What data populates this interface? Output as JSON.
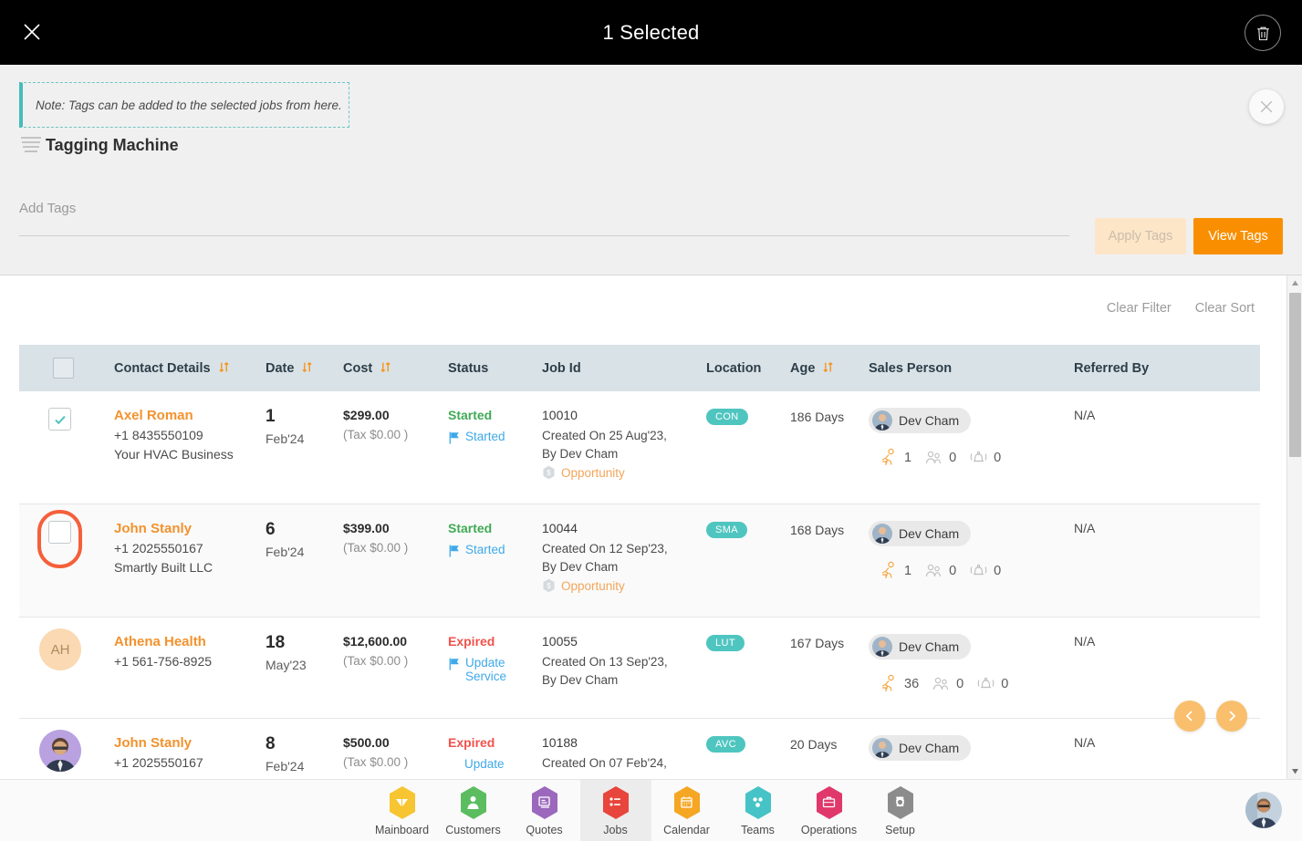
{
  "topbar": {
    "title": "1 Selected",
    "close_icon": "close-icon",
    "delete_icon": "trash-icon"
  },
  "tag_panel": {
    "note": "Note: Tags can be added to the selected jobs from here.",
    "heading": "Tagging Machine",
    "heading_icon": "stacked-lines-icon",
    "close_icon": "close-icon",
    "tags_input_value": "",
    "tags_input_placeholder": "Add Tags",
    "apply_label": "Apply Tags",
    "view_label": "View Tags",
    "accent_orange": "#f98f00",
    "accent_teal": "#45bdb9",
    "apply_disabled_bg": "#fde5c8"
  },
  "table_tools": {
    "clear_filter": "Clear Filter",
    "clear_sort": "Clear Sort"
  },
  "table": {
    "columns": [
      {
        "key": "select",
        "label": "",
        "sortable": false
      },
      {
        "key": "contact",
        "label": "Contact Details",
        "sortable": true
      },
      {
        "key": "date",
        "label": "Date",
        "sortable": true
      },
      {
        "key": "cost",
        "label": "Cost",
        "sortable": true
      },
      {
        "key": "status",
        "label": "Status",
        "sortable": false
      },
      {
        "key": "jobid",
        "label": "Job Id",
        "sortable": false
      },
      {
        "key": "location",
        "label": "Location",
        "sortable": false
      },
      {
        "key": "age",
        "label": "Age",
        "sortable": true
      },
      {
        "key": "sales",
        "label": "Sales Person",
        "sortable": false
      },
      {
        "key": "ref",
        "label": "Referred By",
        "sortable": false
      }
    ],
    "rows": [
      {
        "selected": true,
        "focused": false,
        "avatar_type": "none",
        "avatar_initials": "",
        "name": "Axel Roman",
        "phone": "+1 8435550109",
        "company": "Your HVAC Business",
        "day": "1",
        "month": "Feb'24",
        "cost": "$299.00",
        "tax": "(Tax $0.00 )",
        "status": "Started",
        "status_kind": "started",
        "status_sub": "Started",
        "job_id": "10010",
        "created_on": "Created On 25 Aug'23,",
        "created_by": "By Dev Cham",
        "opportunity": "Opportunity",
        "location": "CON",
        "age": "186 Days",
        "sales_person": "Dev Cham",
        "metric_calls": "1",
        "metric_team": "0",
        "metric_alerts": "0",
        "referred_by": "N/A"
      },
      {
        "selected": false,
        "focused": true,
        "avatar_type": "none",
        "avatar_initials": "",
        "name": "John Stanly",
        "phone": "+1 2025550167",
        "company": "Smartly Built LLC",
        "day": "6",
        "month": "Feb'24",
        "cost": "$399.00",
        "tax": "(Tax $0.00 )",
        "status": "Started",
        "status_kind": "started",
        "status_sub": "Started",
        "job_id": "10044",
        "created_on": "Created On 12 Sep'23,",
        "created_by": "By Dev Cham",
        "opportunity": "Opportunity",
        "location": "SMA",
        "age": "168 Days",
        "sales_person": "Dev Cham",
        "metric_calls": "1",
        "metric_team": "0",
        "metric_alerts": "0",
        "referred_by": "N/A"
      },
      {
        "selected": false,
        "focused": false,
        "avatar_type": "initials",
        "avatar_initials": "AH",
        "name": "Athena Health",
        "phone": "+1 561-756-8925",
        "company": "",
        "day": "18",
        "month": "May'23",
        "cost": "$12,600.00",
        "tax": "(Tax $0.00 )",
        "status": "Expired",
        "status_kind": "expired",
        "status_sub": "Update Service",
        "job_id": "10055",
        "created_on": "Created On 13 Sep'23,",
        "created_by": "By Dev Cham",
        "opportunity": "",
        "location": "LUT",
        "age": "167 Days",
        "sales_person": "Dev Cham",
        "metric_calls": "36",
        "metric_team": "0",
        "metric_alerts": "0",
        "referred_by": "N/A"
      },
      {
        "selected": false,
        "focused": false,
        "avatar_type": "photo",
        "avatar_initials": "",
        "name": "John Stanly",
        "phone": "+1 2025550167",
        "company": "",
        "day": "8",
        "month": "Feb'24",
        "cost": "$500.00",
        "tax": "(Tax $0.00 )",
        "status": "Expired",
        "status_kind": "expired",
        "status_sub": "Update",
        "job_id": "10188",
        "created_on": "Created On 07 Feb'24,",
        "created_by": "",
        "opportunity": "",
        "location": "AVC",
        "age": "20 Days",
        "sales_person": "Dev Cham",
        "metric_calls": "",
        "metric_team": "",
        "metric_alerts": "",
        "referred_by": "N/A"
      }
    ]
  },
  "pager": {
    "prev_icon": "chevron-left-icon",
    "next_icon": "chevron-right-icon"
  },
  "bottom_nav": {
    "active": "Jobs",
    "items": [
      {
        "label": "Mainboard",
        "icon": "mainboard-icon",
        "color": "#f7c531"
      },
      {
        "label": "Customers",
        "icon": "customers-icon",
        "color": "#5bbd5f"
      },
      {
        "label": "Quotes",
        "icon": "quotes-icon",
        "color": "#9b68bd"
      },
      {
        "label": "Jobs",
        "icon": "jobs-icon",
        "color": "#e8453c"
      },
      {
        "label": "Calendar",
        "icon": "calendar-icon",
        "color": "#f5a623"
      },
      {
        "label": "Teams",
        "icon": "teams-icon",
        "color": "#45c3c6"
      },
      {
        "label": "Operations",
        "icon": "operations-icon",
        "color": "#e0386b"
      },
      {
        "label": "Setup",
        "icon": "setup-icon",
        "color": "#8c8c8c"
      }
    ],
    "user_avatar": "user-avatar"
  }
}
